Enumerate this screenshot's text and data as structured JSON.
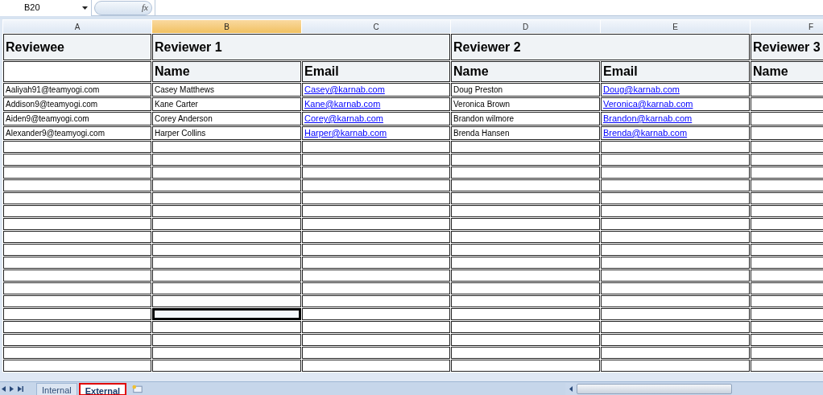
{
  "name_box": "B20",
  "function_label": "fx",
  "columns": [
    {
      "label": "A",
      "selected": false
    },
    {
      "label": "B",
      "selected": true
    },
    {
      "label": "C",
      "selected": false
    },
    {
      "label": "D",
      "selected": false
    },
    {
      "label": "E",
      "selected": false
    },
    {
      "label": "F",
      "selected": false
    }
  ],
  "group_headers": [
    {
      "text": "Reviewee",
      "kind": "single"
    },
    {
      "text": "Reviewer 1",
      "kind": "pair"
    },
    {
      "text": "Reviewer 2",
      "kind": "pair"
    },
    {
      "text": "Reviewer 3",
      "kind": "single"
    }
  ],
  "sub_headers": [
    "Name",
    "Email",
    "Name",
    "Email",
    "Name"
  ],
  "rows": [
    {
      "reviewee": "Aaliyah91@teamyogi.com",
      "r1_name": "Casey Matthews",
      "r1_email": "Casey@karnab.com",
      "r2_name": "Doug Preston",
      "r2_email": "Doug@karnab.com"
    },
    {
      "reviewee": "Addison9@teamyogi.com",
      "r1_name": "Kane Carter",
      "r1_email": "Kane@karnab.com",
      "r2_name": "Veronica Brown",
      "r2_email": "Veronica@karnab.com"
    },
    {
      "reviewee": "Aiden9@teamyogi.com",
      "r1_name": "Corey Anderson",
      "r1_email": "Corey@karnab.com",
      "r2_name": "Brandon wilmore",
      "r2_email": "Brandon@karnab.com"
    },
    {
      "reviewee": "Alexander9@teamyogi.com",
      "r1_name": "Harper Collins",
      "r1_email": "Harper@karnab.com",
      "r2_name": "Brenda Hansen",
      "r2_email": "Brenda@karnab.com"
    }
  ],
  "blank_rows": [
    {
      "selected": false
    },
    {
      "selected": false
    },
    {
      "selected": false
    },
    {
      "selected": false
    },
    {
      "selected": false
    },
    {
      "selected": false
    },
    {
      "selected": false
    },
    {
      "selected": false
    },
    {
      "selected": false
    },
    {
      "selected": false
    },
    {
      "selected": false
    },
    {
      "selected": false
    },
    {
      "selected": false
    },
    {
      "selected": true
    },
    {
      "selected": false
    },
    {
      "selected": false
    },
    {
      "selected": false
    },
    {
      "selected": false
    }
  ],
  "sheet_tabs": [
    {
      "label": "Internal",
      "selected": false
    },
    {
      "label": "External",
      "selected": true
    }
  ]
}
